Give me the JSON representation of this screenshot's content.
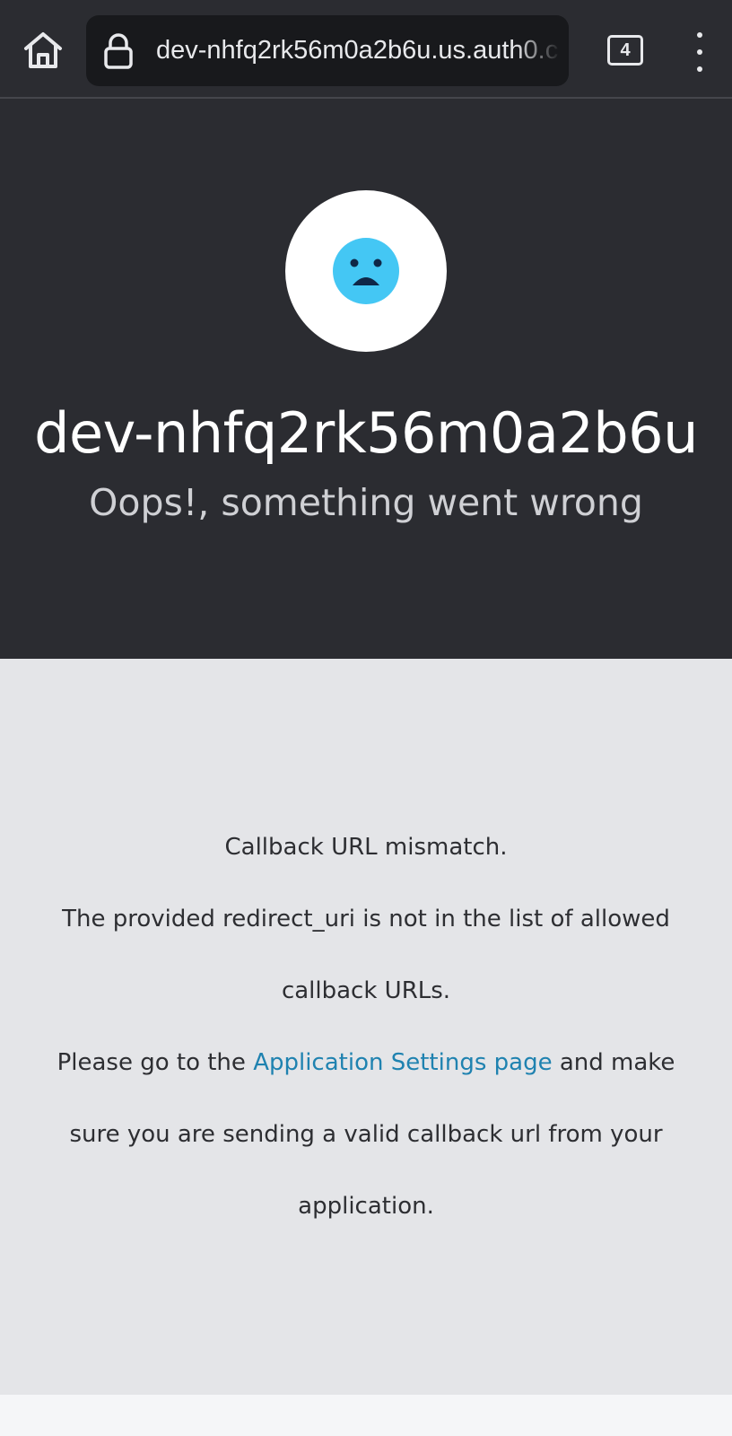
{
  "browser": {
    "url": "dev-nhfq2rk56m0a2b6u.us.auth0.c",
    "tab_count": "4"
  },
  "header": {
    "tenant_name": "dev-nhfq2rk56m0a2b6u",
    "error_title": "Oops!, something went wrong"
  },
  "message": {
    "line1": "Callback URL mismatch.",
    "line2": "The provided redirect_uri is not in the list of allowed",
    "line3": "callback URLs.",
    "line4_before": "Please go to the ",
    "link_text": "Application Settings page",
    "line4_after": " and make",
    "line5": "sure you are sending a valid callback url from your",
    "line6": "application."
  },
  "icons": {
    "home": "home-icon",
    "lock": "lock-icon",
    "menu": "more-vert-icon",
    "sad_face": "sad-face-icon"
  },
  "colors": {
    "header_bg": "#2b2c31",
    "body_bg": "#e4e5e8",
    "link": "#1f82b0",
    "face": "#44c7f4",
    "face_features": "#0f2747"
  }
}
